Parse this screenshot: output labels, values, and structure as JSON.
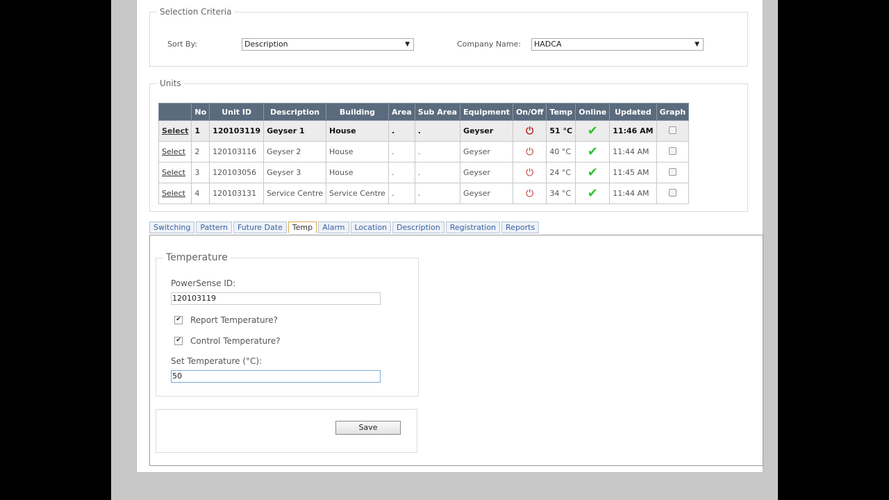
{
  "selection": {
    "legend": "Selection Criteria",
    "sort_label": "Sort By:",
    "sort_value": "Description",
    "company_label": "Company Name:",
    "company_value": "HADCA"
  },
  "units": {
    "legend": "Units",
    "columns": [
      "",
      "No",
      "Unit ID",
      "Description",
      "Building",
      "Area",
      "Sub Area",
      "Equipment",
      "On/Off",
      "Temp",
      "Online",
      "Updated",
      "Graph"
    ],
    "rows": [
      {
        "select": "Select",
        "no": "1",
        "unit_id": "120103119",
        "description": "Geyser 1",
        "building": "House",
        "area": ".",
        "sub_area": ".",
        "equipment": "Geyser",
        "temp": "51 °C",
        "updated": "11:46 AM"
      },
      {
        "select": "Select",
        "no": "2",
        "unit_id": "120103116",
        "description": "Geyser 2",
        "building": "House",
        "area": ".",
        "sub_area": ".",
        "equipment": "Geyser",
        "temp": "40 °C",
        "updated": "11:44 AM"
      },
      {
        "select": "Select",
        "no": "3",
        "unit_id": "120103056",
        "description": "Geyser 3",
        "building": "House",
        "area": ".",
        "sub_area": ".",
        "equipment": "Geyser",
        "temp": "24 °C",
        "updated": "11:45 AM"
      },
      {
        "select": "Select",
        "no": "4",
        "unit_id": "120103131",
        "description": "Service Centre",
        "building": "Service Centre",
        "area": ".",
        "sub_area": ".",
        "equipment": "Geyser",
        "temp": "34 °C",
        "updated": "11:44 AM"
      }
    ],
    "icons": {
      "power": "power-icon",
      "online": "check-icon"
    },
    "colors": {
      "header_bg": "#5a6b7d",
      "power": "#c0302b",
      "online": "#2ec52e"
    }
  },
  "tabs": [
    "Switching",
    "Pattern",
    "Future Date",
    "Temp",
    "Alarm",
    "Location",
    "Description",
    "Registration",
    "Reports"
  ],
  "active_tab": "Temp",
  "temperature": {
    "legend": "Temperature",
    "id_label": "PowerSense ID:",
    "id_value": "120103119",
    "report_label": "Report Temperature?",
    "report_checked": true,
    "control_label": "Control Temperature?",
    "control_checked": true,
    "set_label": "Set Temperature (°C):",
    "set_value": "50"
  },
  "save_label": "Save"
}
